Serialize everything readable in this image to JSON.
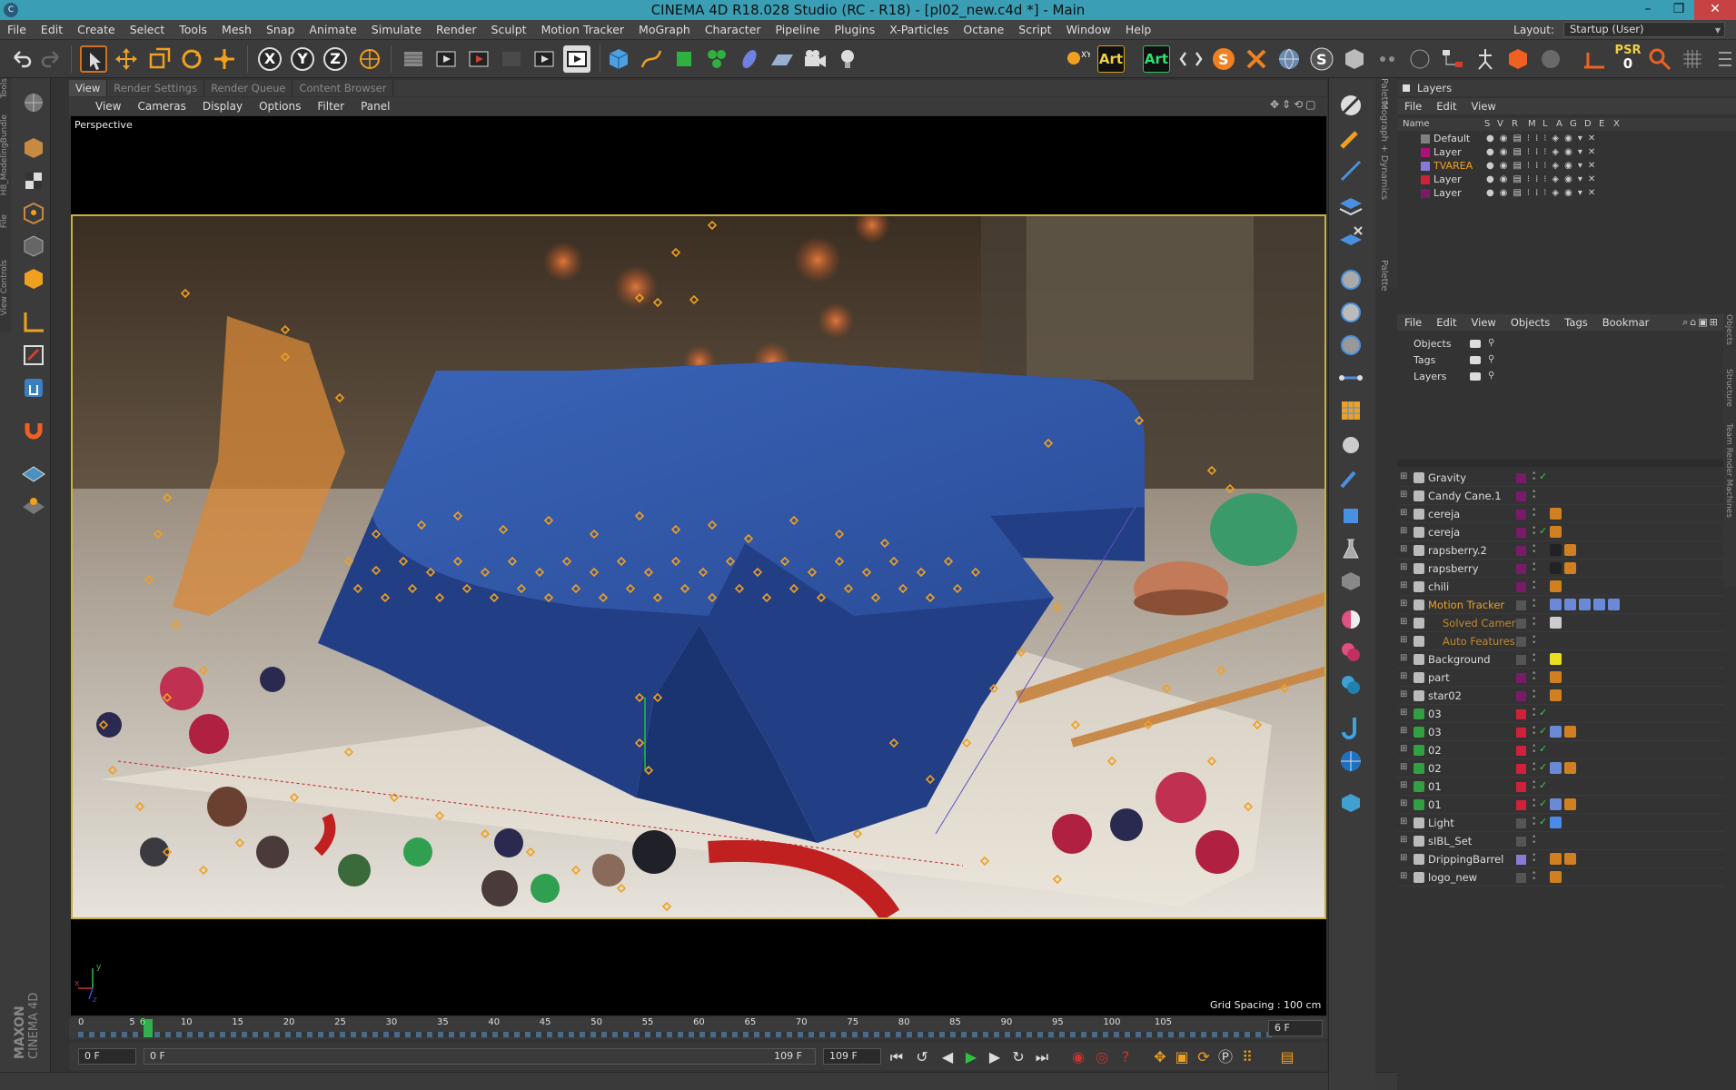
{
  "window": {
    "title": "CINEMA 4D R18.028 Studio (RC - R18) - [pl02_new.c4d *] - Main"
  },
  "menubar": {
    "items": [
      "File",
      "Edit",
      "Create",
      "Select",
      "Tools",
      "Mesh",
      "Snap",
      "Animate",
      "Simulate",
      "Render",
      "Sculpt",
      "Motion Tracker",
      "MoGraph",
      "Character",
      "Pipeline",
      "Plugins",
      "X-Particles",
      "Octane",
      "Script",
      "Window",
      "Help"
    ],
    "layout_label": "Layout:",
    "layout_value": "Startup (User)"
  },
  "toolbar": {
    "axis_x": "X",
    "axis_y": "Y",
    "axis_z": "Z",
    "art_label": "Art",
    "art2_label": "Art",
    "psr_label": "PSR",
    "psr_value": "0"
  },
  "left_vtabs": [
    "Tools",
    "H8_ModelingBundle",
    "File",
    "View Controls"
  ],
  "viewport": {
    "tabs": [
      "View",
      "Render Settings",
      "Render Queue",
      "Content Browser"
    ],
    "active_tab": "View",
    "menu": [
      "View",
      "Cameras",
      "Display",
      "Options",
      "Filter",
      "Panel"
    ],
    "camera_label": "Perspective",
    "grid_spacing": "Grid Spacing : 100 cm",
    "axis_x": "x",
    "axis_y": "y",
    "axis_z": "z",
    "brand_top": "MAXON",
    "brand_bottom": "CINEMA 4D"
  },
  "timeline": {
    "ticks": [
      "0",
      "5",
      "6",
      "10",
      "15",
      "20",
      "25",
      "30",
      "35",
      "40",
      "45",
      "50",
      "55",
      "60",
      "65",
      "70",
      "75",
      "80",
      "85",
      "90",
      "95",
      "100",
      "105"
    ],
    "current_frame_marker": "6",
    "end_field": "6 F",
    "start_field": "0 F",
    "range_start": "0 F",
    "range_end": "109 F",
    "max_field": "109 F"
  },
  "right_vtabs": [
    "Palette",
    "Mograph + Dynamics",
    "Palette"
  ],
  "layers": {
    "title": "Layers",
    "menu": [
      "File",
      "Edit",
      "View"
    ],
    "columns": {
      "name": "Name",
      "s": "S",
      "v": "V",
      "r": "R",
      "m": "M",
      "l": "L",
      "a": "A",
      "g": "G",
      "d": "D",
      "e": "E",
      "x": "X"
    },
    "rows": [
      {
        "name": "Default",
        "color": "#808080"
      },
      {
        "name": "Layer",
        "color": "#b0107a"
      },
      {
        "name": "TVAREA",
        "color": "#8a7ad8"
      },
      {
        "name": "Layer",
        "color": "#d0203a"
      },
      {
        "name": "Layer",
        "color": "#7a1a6a"
      }
    ]
  },
  "objects": {
    "menu": [
      "File",
      "Edit",
      "View",
      "Objects",
      "Tags",
      "Bookmar"
    ],
    "filters": [
      "Objects",
      "Tags",
      "Layers"
    ],
    "rows": [
      {
        "name": "Gravity",
        "color": "#ddd",
        "layer": "#7a1a6a",
        "check": true,
        "tags": []
      },
      {
        "name": "Candy Cane.1",
        "color": "#ddd",
        "layer": "#7a1a6a",
        "check": false,
        "tags": []
      },
      {
        "name": "cereja",
        "color": "#ddd",
        "layer": "#7a1a6a",
        "check": false,
        "tags": [
          "#d08020"
        ]
      },
      {
        "name": "cereja",
        "color": "#ddd",
        "layer": "#7a1a6a",
        "check": true,
        "tags": [
          "#d08020"
        ]
      },
      {
        "name": "rapsberry.2",
        "color": "#ddd",
        "layer": "#7a1a6a",
        "check": false,
        "tags": [
          "#222",
          "#d08020"
        ]
      },
      {
        "name": "rapsberry",
        "color": "#ddd",
        "layer": "#7a1a6a",
        "check": false,
        "tags": [
          "#222",
          "#d08020"
        ]
      },
      {
        "name": "chili",
        "color": "#ddd",
        "layer": "#7a1a6a",
        "check": false,
        "tags": [
          "#d08020"
        ]
      },
      {
        "name": "Motion Tracker",
        "color": "#f0a020",
        "layer": "#555",
        "check": false,
        "tags": [
          "#6a8ad8",
          "#6a8ad8",
          "#6a8ad8",
          "#6a8ad8",
          "#6a8ad8"
        ]
      },
      {
        "name": "Solved Camera",
        "color": "#c08a30",
        "layer": "#555",
        "check": false,
        "tags": [
          "#ccc"
        ]
      },
      {
        "name": "Auto Features",
        "color": "#c08a30",
        "layer": "#555",
        "check": false,
        "tags": []
      },
      {
        "name": "Background",
        "color": "#ddd",
        "layer": "#555",
        "check": false,
        "tags": [
          "#e8e020"
        ]
      },
      {
        "name": "part",
        "color": "#ddd",
        "layer": "#7a1a6a",
        "check": false,
        "tags": [
          "#d08020"
        ]
      },
      {
        "name": "star02",
        "color": "#ddd",
        "layer": "#7a1a6a",
        "check": false,
        "tags": [
          "#d08020"
        ]
      },
      {
        "name": "03",
        "color": "#ddd",
        "layer": "#d0203a",
        "check": true,
        "tags": []
      },
      {
        "name": "03",
        "color": "#ddd",
        "layer": "#d0203a",
        "check": true,
        "tags": [
          "#6a8ad8",
          "#d08020"
        ]
      },
      {
        "name": "02",
        "color": "#ddd",
        "layer": "#d0203a",
        "check": true,
        "tags": []
      },
      {
        "name": "02",
        "color": "#ddd",
        "layer": "#d0203a",
        "check": true,
        "tags": [
          "#6a8ad8",
          "#d08020"
        ]
      },
      {
        "name": "01",
        "color": "#ddd",
        "layer": "#d0203a",
        "check": true,
        "tags": []
      },
      {
        "name": "01",
        "color": "#ddd",
        "layer": "#d0203a",
        "check": true,
        "tags": [
          "#6a8ad8",
          "#d08020"
        ]
      },
      {
        "name": "Light",
        "color": "#ddd",
        "layer": "#555",
        "check": true,
        "tags": [
          "#4a8ae8"
        ]
      },
      {
        "name": "sIBL_Set",
        "color": "#ddd",
        "layer": "#555",
        "check": false,
        "tags": []
      },
      {
        "name": "DrippingBarrel",
        "color": "#ddd",
        "layer": "#8a7ad8",
        "check": false,
        "tags": [
          "#d08020",
          "#d08020"
        ]
      },
      {
        "name": "logo_new",
        "color": "#ddd",
        "layer": "#555",
        "check": false,
        "tags": [
          "#d08020"
        ]
      }
    ]
  },
  "objects_vtabs": [
    "Objects",
    "Structure",
    "Team Render Machines"
  ]
}
